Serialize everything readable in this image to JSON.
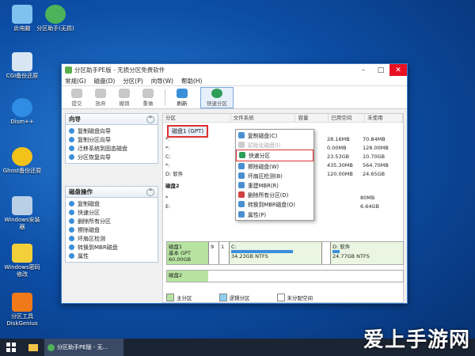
{
  "desktop": {
    "icons": [
      {
        "label": "此电脑"
      },
      {
        "label": "分区助手(无损)"
      },
      {
        "label": "CGI备份还原"
      },
      {
        "label": "Dism++"
      },
      {
        "label": "Ghost备份还原"
      },
      {
        "label": "Windows安装器"
      },
      {
        "label": "Windows密码修改"
      },
      {
        "label": "分区工具DiskGenius"
      }
    ]
  },
  "window": {
    "title": "分区助手PE版 - 无损分区免费软件",
    "menu": [
      "常规(G)",
      "磁盘(D)",
      "分区(P)",
      "向导(W)",
      "帮助(H)"
    ],
    "toolbar": {
      "submit": "提交",
      "discard": "放弃",
      "undo": "撤销",
      "redo": "重做",
      "refresh": "刷新",
      "quick_partition": "快速分区"
    }
  },
  "left": {
    "wizard_title": "向导",
    "wizard_items": [
      "复制磁盘向导",
      "复制分区向导",
      "迁移系统到固态磁盘",
      "分区恢复向导"
    ],
    "ops_title": "磁盘操作",
    "ops_items": [
      "复制磁盘",
      "快速分区",
      "删除所有分区",
      "擦除磁盘",
      "坏扇区检测",
      "转换到MBR磁盘",
      "属性"
    ]
  },
  "table": {
    "headers": [
      "分区",
      "文件系统",
      "容量",
      "已用空间",
      "未使用"
    ],
    "disk1_label": "磁盘1 (GPT)",
    "rows": [
      {
        "name": "*:",
        "cap": "MB",
        "used": "28.16MB",
        "free": "70.84MB"
      },
      {
        "name": "*:",
        "cap": "MB",
        "used": "0.00MB",
        "free": "128.00MB"
      },
      {
        "name": "C:",
        "cap": "GB",
        "used": "23.53GB",
        "free": "10.70GB"
      },
      {
        "name": "*:",
        "cap": "MB",
        "used": "435.30MB",
        "free": "564.70MB"
      },
      {
        "name": "D: 软件",
        "cap": "GB",
        "used": "120.00MB",
        "free": "24.65GB"
      }
    ],
    "disk2_label": "磁盘2",
    "rows2": [
      {
        "name": "*",
        "cap": "",
        "used": "",
        "free": "80MB"
      },
      {
        "name": "E:",
        "cap": "",
        "used": "",
        "free": "6.64GB"
      }
    ]
  },
  "context_menu": {
    "items": [
      "复制磁盘(C)",
      "初始化磁盘(I)",
      "快速分区",
      "擦除磁盘(W)",
      "坏扇区检测(B)",
      "重建MBR(R)",
      "删除所有分区(D)",
      "转换到MBR磁盘(O)",
      "属性(P)"
    ]
  },
  "diskmap": {
    "disk1": {
      "name": "磁盘1",
      "type": "基本 GPT",
      "size": "60.00GB",
      "seg1": "9",
      "seg2": "1",
      "c_label": "C:",
      "c_info": "34.23GB NTFS",
      "d_label": "D: 软件",
      "d_info": "24.77GB NTFS"
    },
    "disk2": {
      "name": "磁盘2"
    }
  },
  "legend": [
    "主分区",
    "逻辑分区",
    "未分配空间"
  ],
  "taskbar": {
    "app": "分区助手PE版 - 无..."
  },
  "watermark": "爱上手游网",
  "colors": {
    "accent": "#3a8fd9",
    "primary_partition": "#b7e3a0",
    "highlight": "#e03030"
  }
}
